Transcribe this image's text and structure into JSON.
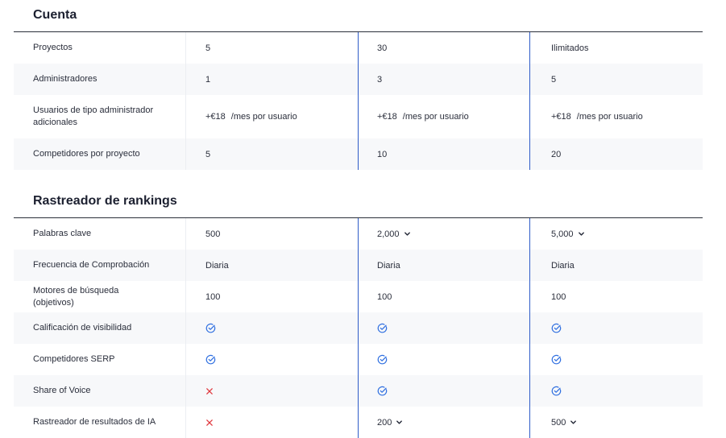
{
  "sections": [
    {
      "title": "Cuenta",
      "rows": [
        {
          "label": "Proyectos",
          "cells": [
            {
              "type": "text",
              "text": "5"
            },
            {
              "type": "text",
              "text": "30"
            },
            {
              "type": "text",
              "text": "Ilimitados"
            }
          ]
        },
        {
          "label": "Administradores",
          "cells": [
            {
              "type": "text",
              "text": "1"
            },
            {
              "type": "text",
              "text": "3"
            },
            {
              "type": "text",
              "text": "5"
            }
          ]
        },
        {
          "label": "Usuarios de tipo administrador adicionales",
          "cells": [
            {
              "type": "price",
              "price": "+€18",
              "unit": "/mes por usuario"
            },
            {
              "type": "price",
              "price": "+€18",
              "unit": "/mes por usuario"
            },
            {
              "type": "price",
              "price": "+€18",
              "unit": "/mes por usuario"
            }
          ]
        },
        {
          "label": "Competidores por proyecto",
          "cells": [
            {
              "type": "text",
              "text": "5"
            },
            {
              "type": "text",
              "text": "10"
            },
            {
              "type": "text",
              "text": "20"
            }
          ]
        }
      ]
    },
    {
      "title": "Rastreador de rankings",
      "rows": [
        {
          "label": "Palabras clave",
          "cells": [
            {
              "type": "text",
              "text": "500"
            },
            {
              "type": "select",
              "text": "2,000"
            },
            {
              "type": "select",
              "text": "5,000"
            }
          ]
        },
        {
          "label": "Frecuencia de Comprobación",
          "cells": [
            {
              "type": "text",
              "text": "Diaria"
            },
            {
              "type": "text",
              "text": "Diaria"
            },
            {
              "type": "text",
              "text": "Diaria"
            }
          ]
        },
        {
          "label": "Motores de búsqueda (objetivos)",
          "cells": [
            {
              "type": "text",
              "text": "100"
            },
            {
              "type": "text",
              "text": "100"
            },
            {
              "type": "text",
              "text": "100"
            }
          ]
        },
        {
          "label": "Calificación de visibilidad",
          "cells": [
            {
              "type": "check"
            },
            {
              "type": "check"
            },
            {
              "type": "check"
            }
          ]
        },
        {
          "label": "Competidores SERP",
          "cells": [
            {
              "type": "check"
            },
            {
              "type": "check"
            },
            {
              "type": "check"
            }
          ]
        },
        {
          "label": "Share of Voice",
          "cells": [
            {
              "type": "cross"
            },
            {
              "type": "check"
            },
            {
              "type": "check"
            }
          ]
        },
        {
          "label": "Rastreador de resultados de IA",
          "cells": [
            {
              "type": "cross"
            },
            {
              "type": "select",
              "text": "200"
            },
            {
              "type": "select",
              "text": "500"
            }
          ]
        }
      ]
    }
  ],
  "colors": {
    "accent": "#2f5cc8",
    "check": "#2f6fe0",
    "cross": "#e0383e",
    "row_shade": "#f7f8fa"
  }
}
